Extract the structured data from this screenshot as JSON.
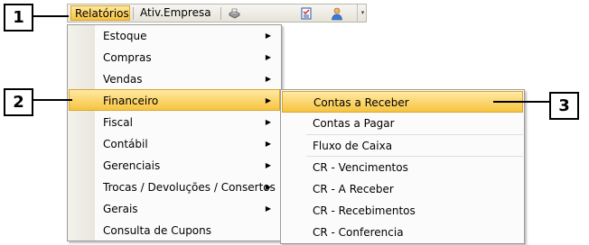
{
  "toolbar": {
    "relatorios_label": "Relatórios",
    "ativ_empresa_label": "Ativ.Empresa",
    "icons": [
      "printer-icon",
      "checklist-icon",
      "user-icon"
    ],
    "overflow": "▾"
  },
  "menu": {
    "items": [
      {
        "label": "Estoque",
        "has_submenu": true
      },
      {
        "label": "Compras",
        "has_submenu": true
      },
      {
        "label": "Vendas",
        "has_submenu": true
      },
      {
        "label": "Financeiro",
        "has_submenu": true,
        "highlighted": true
      },
      {
        "label": "Fiscal",
        "has_submenu": true
      },
      {
        "label": "Contábil",
        "has_submenu": true
      },
      {
        "label": "Gerenciais",
        "has_submenu": true
      },
      {
        "label": "Trocas / Devoluções / Consertos",
        "has_submenu": true
      },
      {
        "label": "Gerais",
        "has_submenu": true
      },
      {
        "label": "Consulta de Cupons",
        "has_submenu": false
      }
    ],
    "arrow": "▶"
  },
  "submenu": {
    "items": [
      {
        "label": "Contas a Receber",
        "highlighted": true
      },
      {
        "label": "Contas a Pagar"
      },
      {
        "label": "Fluxo de Caixa"
      },
      {
        "label": "CR - Vencimentos"
      },
      {
        "label": "CR - A Receber"
      },
      {
        "label": "CR - Recebimentos"
      },
      {
        "label": "CR - Conferencia"
      }
    ]
  },
  "callouts": [
    "1",
    "2",
    "3"
  ],
  "colors": {
    "highlight_top": "#ffe9a4",
    "highlight_bottom": "#f7c43f",
    "highlight_border": "#d9a531"
  }
}
